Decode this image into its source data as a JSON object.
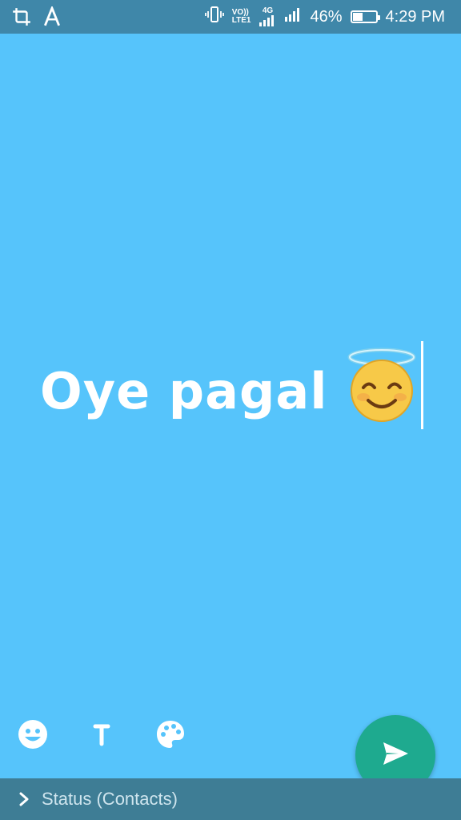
{
  "status_bar": {
    "left_icons": [
      "crop-icon",
      "text-style-icon"
    ],
    "right_icons": [
      "vibrate-icon",
      "volte-icon",
      "signal-4g-icon",
      "signal-icon",
      "battery-icon"
    ],
    "volte_label_top": "VO))",
    "volte_label_bottom": "LTE1",
    "network_label": "4G",
    "battery_percent": "46%",
    "battery_level": 0.46,
    "time": "4:29 PM"
  },
  "canvas": {
    "background_color": "#56c4fb",
    "status_text": "Oye pagal",
    "emoji": "smiling-face-with-halo"
  },
  "tools": [
    {
      "name": "emoji-tool",
      "icon": "smiley-icon"
    },
    {
      "name": "text-tool",
      "icon": "text-t-icon"
    },
    {
      "name": "color-tool",
      "icon": "palette-icon"
    }
  ],
  "send_button": {
    "icon": "send-icon",
    "color": "#1eaa8f"
  },
  "bottom_bar": {
    "icon": "chevron-right-icon",
    "audience_label": "Status (Contacts)"
  }
}
